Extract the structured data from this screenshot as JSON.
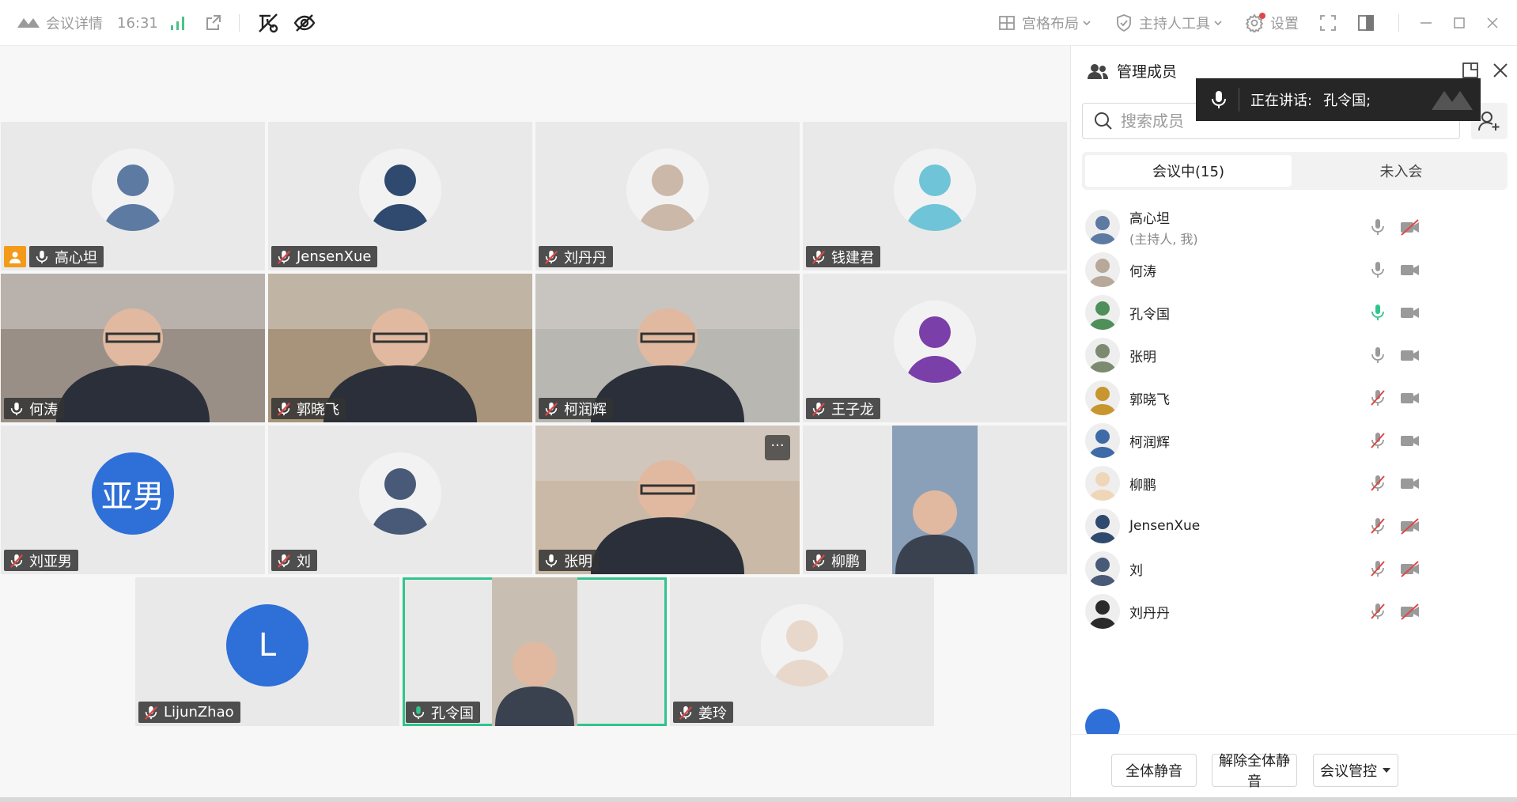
{
  "topbar": {
    "meeting_details": "会议详情",
    "time": "16:31",
    "grid_layout": "宫格布局",
    "host_tools": "主持人工具",
    "settings": "设置"
  },
  "speaking_toast": {
    "label": "正在讲话:",
    "name": "孔令国;"
  },
  "panel": {
    "title": "管理成员",
    "search_placeholder": "搜索成员",
    "tab_in_meeting": "会议中(15)",
    "tab_not_joined": "未入会",
    "mute_all": "全体静音",
    "unmute_all": "解除全体静音",
    "meeting_control": "会议管控"
  },
  "tiles": [
    {
      "name": "高心坦",
      "mic": "on",
      "host": true,
      "kind": "avatar",
      "color": "#5d7aa3"
    },
    {
      "name": "JensenXue",
      "mic": "muted",
      "kind": "avatar",
      "color": "#2f4a6e"
    },
    {
      "name": "刘丹丹",
      "mic": "muted",
      "kind": "avatar",
      "color": "#cbb8a8"
    },
    {
      "name": "钱建君",
      "mic": "muted",
      "kind": "avatar",
      "color": "#6fc4d8"
    },
    {
      "name": "何涛",
      "mic": "on",
      "kind": "video",
      "color": "#9a8f86"
    },
    {
      "name": "郭晓飞",
      "mic": "muted",
      "kind": "video",
      "color": "#a8947a"
    },
    {
      "name": "柯润辉",
      "mic": "muted",
      "kind": "video",
      "color": "#b9b7b2"
    },
    {
      "name": "王子龙",
      "mic": "muted",
      "kind": "avatar",
      "color": "#7a3fa8"
    },
    {
      "name": "刘亚男",
      "mic": "muted",
      "kind": "initial",
      "initial": "亚男"
    },
    {
      "name": "刘",
      "mic": "muted",
      "kind": "avatar",
      "color": "#485a78"
    },
    {
      "name": "张明",
      "mic": "on",
      "kind": "video",
      "color": "#c9b9a6",
      "more": "···"
    },
    {
      "name": "柳鹏",
      "mic": "muted",
      "kind": "portrait",
      "color": "#8aa0b8"
    },
    {
      "name": "LijunZhao",
      "mic": "muted",
      "kind": "initial",
      "initial": "L"
    },
    {
      "name": "孔令国",
      "mic": "speaking",
      "kind": "portrait",
      "color": "#c8bfb2",
      "active": true
    },
    {
      "name": "姜玲",
      "mic": "muted",
      "kind": "avatar",
      "color": "#e8d8cc"
    }
  ],
  "members": [
    {
      "name": "高心坦",
      "sub": "(主持人, 我)",
      "mic": "on",
      "cam": "off",
      "color": "#5d7aa3"
    },
    {
      "name": "何涛",
      "mic": "on",
      "cam": "on",
      "color": "#b8a899"
    },
    {
      "name": "孔令国",
      "mic": "speaking",
      "cam": "on",
      "color": "#4f8f5a"
    },
    {
      "name": "张明",
      "mic": "on",
      "cam": "on",
      "color": "#7c8a70"
    },
    {
      "name": "郭晓飞",
      "mic": "muted",
      "cam": "on",
      "color": "#c8962e"
    },
    {
      "name": "柯润辉",
      "mic": "muted",
      "cam": "on",
      "color": "#3f6aa8"
    },
    {
      "name": "柳鹏",
      "mic": "muted",
      "cam": "on",
      "color": "#f0d6b8"
    },
    {
      "name": "JensenXue",
      "mic": "muted",
      "cam": "off",
      "color": "#2f4a6e"
    },
    {
      "name": "刘",
      "mic": "muted",
      "cam": "off",
      "color": "#485a78"
    },
    {
      "name": "刘丹丹",
      "mic": "muted",
      "cam": "off",
      "color": "#2b2b2b"
    }
  ],
  "colors": {
    "accent_green": "#30c48d",
    "host_orange": "#f39a1b",
    "initial_blue": "#2f6fd8",
    "muted_red": "#e04646"
  }
}
